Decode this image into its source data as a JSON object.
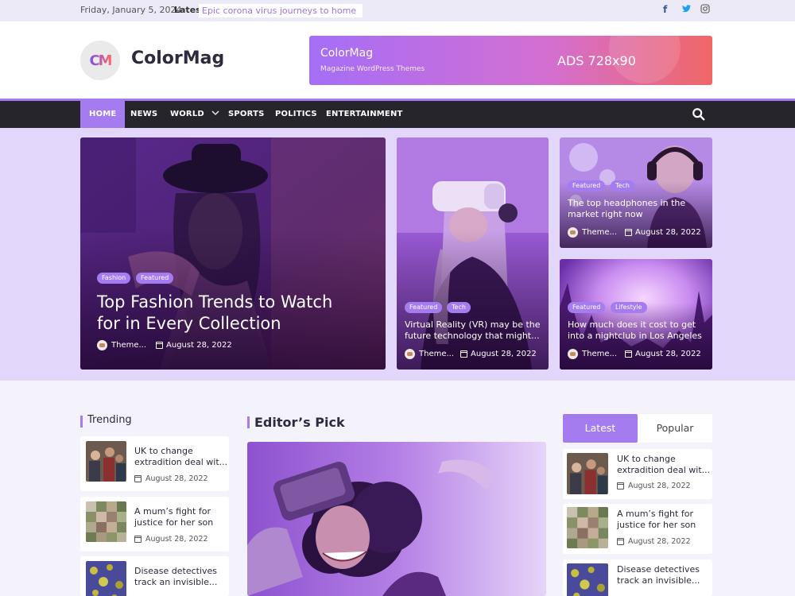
{
  "topbar": {
    "date": "Friday, January 5, 2024",
    "latest_label": "Latest:",
    "latest_headline": "Epic corona virus journeys to home",
    "social": [
      "facebook-icon",
      "twitter-icon",
      "instagram-icon"
    ]
  },
  "header": {
    "logo_text": "CM",
    "site_title": "ColorMag",
    "ad": {
      "title": "ColorMag",
      "subtitle": "Magazine WordPress Themes",
      "size_label": "ADS 728x90"
    }
  },
  "nav": {
    "items": [
      "HOME",
      "NEWS",
      "WORLD",
      "SPORTS",
      "POLITICS",
      "ENTERTAINMENT"
    ],
    "active": "HOME"
  },
  "featured": {
    "main": {
      "tags": [
        "Fashion",
        "Featured"
      ],
      "title_line1": "Top Fashion Trends to Watch",
      "title_line2": "for in Every Collection",
      "author": "Theme...",
      "date": "August 28, 2022"
    },
    "middle": {
      "tags": [
        "Featured",
        "Tech"
      ],
      "title_line1": "Virtual Reality (VR) may be the",
      "title_line2": "future technology that might...",
      "author": "Theme...",
      "date": "August 28, 2022"
    },
    "right_top": {
      "tags": [
        "Featured",
        "Tech"
      ],
      "title_line1": "The top headphones in the",
      "title_line2": "market right now",
      "author": "Theme...",
      "date": "August 28, 2022"
    },
    "right_bottom": {
      "tags": [
        "Featured",
        "Lifestyle"
      ],
      "title_line1": "How much does it cost to get",
      "title_line2": "into a nightclub in Los Angeles",
      "author": "Theme...",
      "date": "August 28, 2022"
    }
  },
  "trending": {
    "heading": "Trending",
    "items": [
      {
        "line1": "UK to change",
        "line2": "extradition deal wit...",
        "date": "August 28, 2022"
      },
      {
        "line1": "A mum’s fight for",
        "line2": "justice for her son",
        "date": "August 28, 2022"
      },
      {
        "line1": "Disease detectives",
        "line2": "track an invisible...",
        "date": ""
      }
    ]
  },
  "editors_pick": {
    "heading": "Editor’s Pick"
  },
  "sidebar": {
    "tabs": [
      "Latest",
      "Popular"
    ],
    "active_tab": "Latest",
    "items": [
      {
        "line1": "UK to change",
        "line2": "extradition deal wit...",
        "date": "August 28, 2022"
      },
      {
        "line1": "A mum’s fight for",
        "line2": "justice for her son",
        "date": "August 28, 2022"
      },
      {
        "line1": "Disease detectives",
        "line2": "track an invisible...",
        "date": ""
      }
    ]
  },
  "colors": {
    "accent": "#a47cf0",
    "nav_bg": "#26252b",
    "band_bg": "#e2d6fb"
  }
}
